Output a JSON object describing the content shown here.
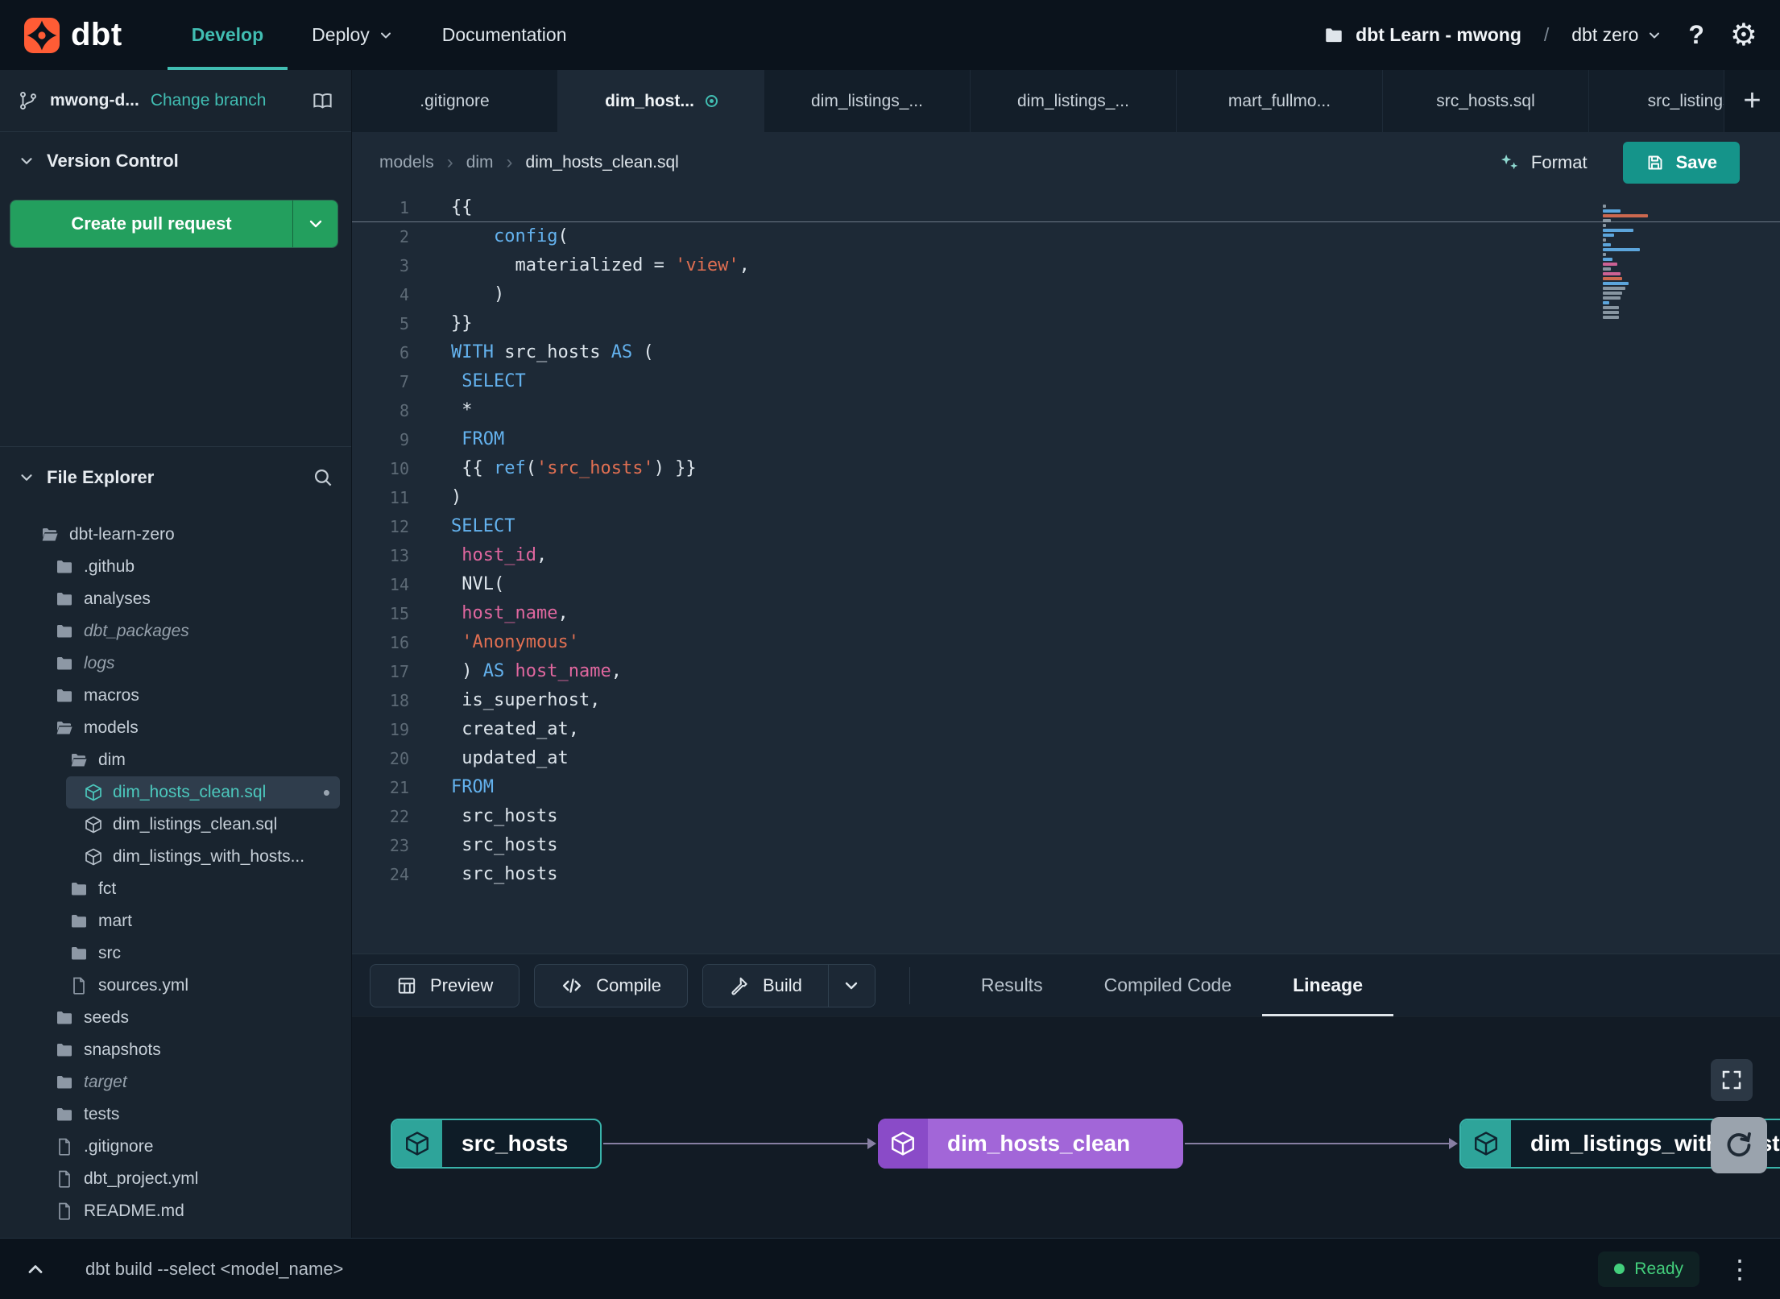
{
  "colors": {
    "accent_teal": "#41bdb2",
    "accent_green": "#239f5e",
    "accent_orange": "#ff5c35",
    "node_purple": "#a266d8",
    "ready_green": "#43cf7c"
  },
  "glyphs": {
    "plus": "+",
    "kebab": "⋮",
    "dot": "•",
    "crumb_sep": "›",
    "gear": "⚙",
    "help": "?"
  },
  "topbar": {
    "brand": "dbt",
    "nav": [
      {
        "label": "Develop",
        "active": true
      },
      {
        "label": "Deploy",
        "chevron": true
      },
      {
        "label": "Documentation"
      }
    ],
    "project_label": "dbt Learn - mwong",
    "separator": "/",
    "env_label": "dbt zero"
  },
  "sidebar": {
    "branch_name": "mwong-d...",
    "change_branch_label": "Change branch",
    "version_control_title": "Version Control",
    "create_pr_label": "Create pull request",
    "file_explorer_title": "File Explorer",
    "tree": [
      {
        "label": "dbt-learn-zero",
        "type": "folder-open",
        "level": 0
      },
      {
        "label": ".github",
        "type": "folder",
        "level": 1
      },
      {
        "label": "analyses",
        "type": "folder",
        "level": 1
      },
      {
        "label": "dbt_packages",
        "type": "folder",
        "level": 1,
        "italic": true
      },
      {
        "label": "logs",
        "type": "folder",
        "level": 1,
        "italic": true
      },
      {
        "label": "macros",
        "type": "folder",
        "level": 1
      },
      {
        "label": "models",
        "type": "folder-open",
        "level": 1
      },
      {
        "label": "dim",
        "type": "folder-open",
        "level": 2
      },
      {
        "label": "dim_hosts_clean.sql",
        "type": "model",
        "level": 3,
        "selected": true,
        "modified": true
      },
      {
        "label": "dim_listings_clean.sql",
        "type": "model",
        "level": 3
      },
      {
        "label": "dim_listings_with_hosts...",
        "type": "model",
        "level": 3
      },
      {
        "label": "fct",
        "type": "folder",
        "level": 2
      },
      {
        "label": "mart",
        "type": "folder",
        "level": 2
      },
      {
        "label": "src",
        "type": "folder",
        "level": 2
      },
      {
        "label": "sources.yml",
        "type": "file",
        "level": 2
      },
      {
        "label": "seeds",
        "type": "folder",
        "level": 1
      },
      {
        "label": "snapshots",
        "type": "folder",
        "level": 1
      },
      {
        "label": "target",
        "type": "folder",
        "level": 1,
        "italic": true
      },
      {
        "label": "tests",
        "type": "folder",
        "level": 1
      },
      {
        "label": ".gitignore",
        "type": "file",
        "level": 1
      },
      {
        "label": "dbt_project.yml",
        "type": "file",
        "level": 1
      },
      {
        "label": "README.md",
        "type": "file",
        "level": 1
      }
    ]
  },
  "tabbar": {
    "tabs": [
      {
        "label": ".gitignore"
      },
      {
        "label": "dim_host...",
        "active": true,
        "modified": true
      },
      {
        "label": "dim_listings_..."
      },
      {
        "label": "dim_listings_..."
      },
      {
        "label": "mart_fullmo..."
      },
      {
        "label": "src_hosts.sql"
      },
      {
        "label": "src_listings."
      }
    ]
  },
  "editor": {
    "breadcrumb": [
      "models",
      "dim",
      "dim_hosts_clean.sql"
    ],
    "format_label": "Format",
    "save_label": "Save",
    "lines": [
      [
        {
          "t": "{{",
          "c": "d"
        }
      ],
      [
        {
          "t": "    ",
          "c": "d"
        },
        {
          "t": "config",
          "c": "fn"
        },
        {
          "t": "(",
          "c": "d"
        }
      ],
      [
        {
          "t": "      materialized = ",
          "c": "d"
        },
        {
          "t": "'view'",
          "c": "str"
        },
        {
          "t": ",",
          "c": "d"
        }
      ],
      [
        {
          "t": "    )",
          "c": "d"
        }
      ],
      [
        {
          "t": "}}",
          "c": "d"
        }
      ],
      [
        {
          "t": "WITH",
          "c": "kw"
        },
        {
          "t": " src_hosts ",
          "c": "d"
        },
        {
          "t": "AS",
          "c": "kw"
        },
        {
          "t": " (",
          "c": "d"
        }
      ],
      [
        {
          "t": " ",
          "c": "d"
        },
        {
          "t": "SELECT",
          "c": "kw"
        }
      ],
      [
        {
          "t": " *",
          "c": "d"
        }
      ],
      [
        {
          "t": " ",
          "c": "d"
        },
        {
          "t": "FROM",
          "c": "kw"
        }
      ],
      [
        {
          "t": " {{ ",
          "c": "d"
        },
        {
          "t": "ref",
          "c": "fn"
        },
        {
          "t": "(",
          "c": "d"
        },
        {
          "t": "'src_hosts'",
          "c": "str"
        },
        {
          "t": ") }}",
          "c": "d"
        }
      ],
      [
        {
          "t": ")",
          "c": "d"
        }
      ],
      [
        {
          "t": "SELECT",
          "c": "kw"
        }
      ],
      [
        {
          "t": " ",
          "c": "d"
        },
        {
          "t": "host_id",
          "c": "var"
        },
        {
          "t": ",",
          "c": "d"
        }
      ],
      [
        {
          "t": " NVL(",
          "c": "d"
        }
      ],
      [
        {
          "t": " ",
          "c": "d"
        },
        {
          "t": "host_name",
          "c": "var"
        },
        {
          "t": ",",
          "c": "d"
        }
      ],
      [
        {
          "t": " ",
          "c": "d"
        },
        {
          "t": "'Anonymous'",
          "c": "str"
        }
      ],
      [
        {
          "t": " ) ",
          "c": "d"
        },
        {
          "t": "AS",
          "c": "kw"
        },
        {
          "t": " ",
          "c": "d"
        },
        {
          "t": "host_name",
          "c": "var"
        },
        {
          "t": ",",
          "c": "d"
        }
      ],
      [
        {
          "t": " is_superhost,",
          "c": "d"
        }
      ],
      [
        {
          "t": " created_at,",
          "c": "d"
        }
      ],
      [
        {
          "t": " updated_at",
          "c": "d"
        }
      ],
      [
        {
          "t": "FROM",
          "c": "kw"
        }
      ],
      [
        {
          "t": " src_hosts",
          "c": "d"
        }
      ],
      [
        {
          "t": " src_hosts",
          "c": "d"
        }
      ],
      [
        {
          "t": " src_hosts",
          "c": "d"
        }
      ]
    ]
  },
  "panel": {
    "preview_label": "Preview",
    "compile_label": "Compile",
    "build_label": "Build",
    "tabs": [
      {
        "label": "Results"
      },
      {
        "label": "Compiled Code"
      },
      {
        "label": "Lineage",
        "active": true
      }
    ]
  },
  "lineage": {
    "nodes": [
      {
        "label": "src_hosts",
        "style": "teal"
      },
      {
        "label": "dim_hosts_clean",
        "style": "purple"
      },
      {
        "label": "dim_listings_with_hosts",
        "style": "teal"
      }
    ]
  },
  "statusbar": {
    "command": "dbt build --select <model_name>",
    "status": "Ready"
  }
}
